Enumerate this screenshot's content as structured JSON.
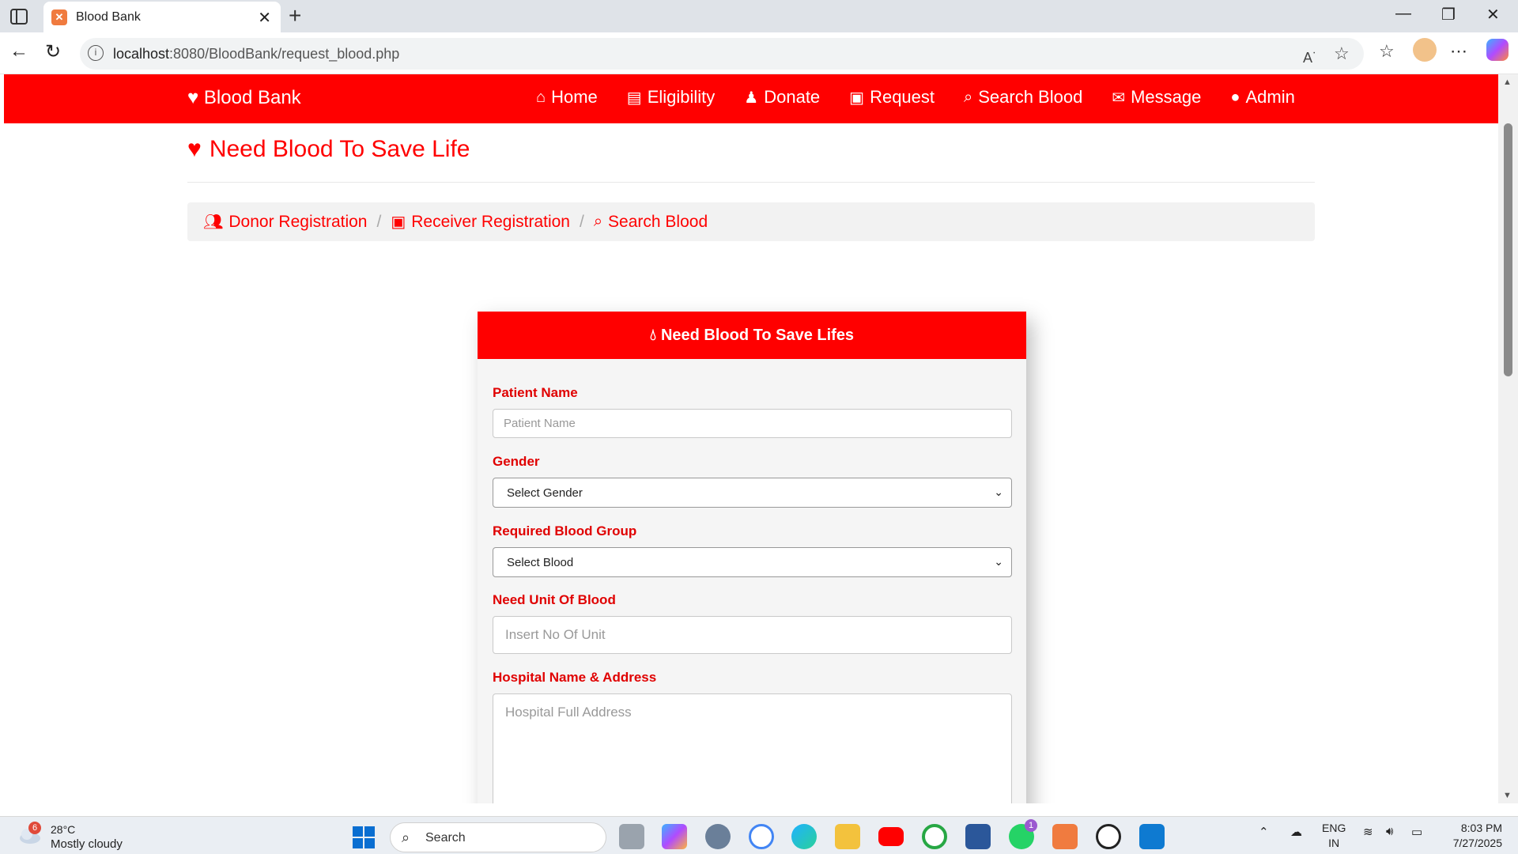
{
  "browser": {
    "tab_title": "Blood Bank",
    "url_host": "localhost",
    "url_path": ":8080/BloodBank/request_blood.php"
  },
  "site": {
    "brand": "Blood Bank",
    "menu": [
      {
        "label": "Home",
        "icon": "home-icon"
      },
      {
        "label": "Eligibility",
        "icon": "clipboard-icon"
      },
      {
        "label": "Donate",
        "icon": "donate-icon"
      },
      {
        "label": "Request",
        "icon": "hospital-user-icon"
      },
      {
        "label": "Search Blood",
        "icon": "search-icon"
      },
      {
        "label": "Message",
        "icon": "envelope-icon"
      },
      {
        "label": "Admin",
        "icon": "user-icon"
      }
    ],
    "heading": "Need Blood To Save Life",
    "breadcrumb": [
      {
        "label": "Donor Registration",
        "icon": "users-icon"
      },
      {
        "label": "Receiver Registration",
        "icon": "hospital-user-icon"
      },
      {
        "label": "Search Blood",
        "icon": "search-icon"
      }
    ]
  },
  "form": {
    "title": "Need Blood To Save Lifes",
    "patient_label": "Patient Name",
    "patient_placeholder": "Patient Name",
    "gender_label": "Gender",
    "gender_value": "Select Gender",
    "blood_label": "Required Blood Group",
    "blood_value": "Select Blood",
    "units_label": "Need Unit Of Blood",
    "units_placeholder": "Insert No Of Unit",
    "hospital_label": "Hospital Name & Address",
    "hospital_placeholder": "Hospital Full Address"
  },
  "taskbar": {
    "temperature": "28°C",
    "weather": "Mostly cloudy",
    "weather_badge": "6",
    "search_label": "Search",
    "lang1": "ENG",
    "lang2": "IN",
    "time": "8:03 PM",
    "date": "7/27/2025",
    "whatsapp_badge": "1"
  },
  "colors": {
    "brand_red": "#ff0000",
    "card_bg": "#f5f5f5"
  }
}
